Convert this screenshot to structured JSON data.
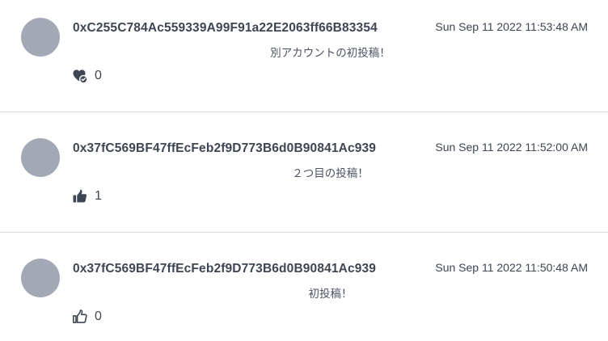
{
  "posts": [
    {
      "author": "0xC255C784Ac559339A99F91a22E2063ff66B83354",
      "timestamp": "Sun Sep 11 2022 11:53:48 AM",
      "message": "別アカウントの初投稿！",
      "reaction_icon": "heart-check-icon",
      "count": "0"
    },
    {
      "author": "0x37fC569BF47ffEcFeb2f9D773B6d0B90841Ac939",
      "timestamp": "Sun Sep 11 2022 11:52:00 AM",
      "message": "２つ目の投稿！",
      "reaction_icon": "thumbs-up-filled-icon",
      "count": "1"
    },
    {
      "author": "0x37fC569BF47ffEcFeb2f9D773B6d0B90841Ac939",
      "timestamp": "Sun Sep 11 2022 11:50:48 AM",
      "message": "初投稿！",
      "reaction_icon": "thumbs-up-outline-icon",
      "count": "0"
    }
  ],
  "colors": {
    "avatar": "#a3a8b5",
    "text": "#3e4553",
    "divider": "#d9dbe0"
  }
}
